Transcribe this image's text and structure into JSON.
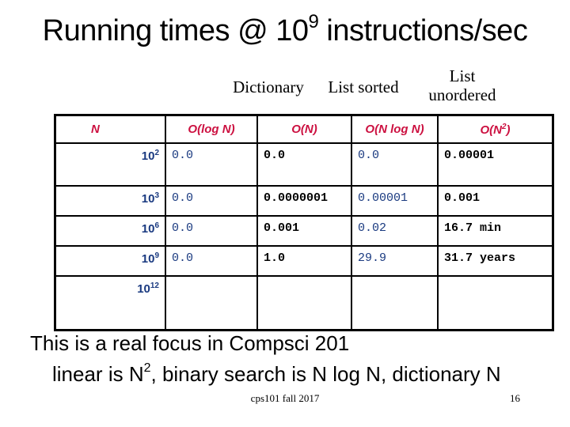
{
  "title": {
    "text": "Running times @ 10",
    "exp": "9",
    "suffix": " instructions/sec"
  },
  "column_labels": {
    "dictionary": "Dictionary",
    "list_sorted": "List sorted",
    "list_unordered_line1": "List",
    "list_unordered_line2": "unordered"
  },
  "table": {
    "headers": [
      {
        "text": "N",
        "sup": ""
      },
      {
        "text": "O(log N)",
        "sup": ""
      },
      {
        "text": "O(N)",
        "sup": ""
      },
      {
        "text": "O(N log N)",
        "sup": ""
      },
      {
        "text": "O(N",
        "sup": "2",
        "close": ")"
      }
    ],
    "rows": [
      {
        "n_base": "10",
        "n_exp": "2",
        "log_n": "0.0",
        "n": "0.0",
        "n_log_n": "0.0",
        "n2": "0.00001"
      },
      {
        "n_base": "10",
        "n_exp": "3",
        "log_n": "0.0",
        "n": "0.0000001",
        "n_log_n": "0.00001",
        "n2": "0.001"
      },
      {
        "n_base": "10",
        "n_exp": "6",
        "log_n": "0.0",
        "n": "0.001",
        "n_log_n": "0.02",
        "n2": "16.7 min"
      },
      {
        "n_base": "10",
        "n_exp": "9",
        "log_n": "0.0",
        "n": "1.0",
        "n_log_n": "29.9",
        "n2": "31.7 years"
      },
      {
        "n_base": "10",
        "n_exp": "12",
        "log_n": "",
        "n": "",
        "n_log_n": "",
        "n2": ""
      }
    ]
  },
  "bullets": {
    "line1": "This is a real focus in Compsci 201",
    "line2_a": "linear is N",
    "line2_sup": "2",
    "line2_b": ", binary search is N log N, dictionary N"
  },
  "footer": {
    "text": "cps101 fall 2017",
    "page": "16"
  },
  "colors": {
    "header_text": "#cc1040",
    "blue_text": "#1a3a80"
  }
}
